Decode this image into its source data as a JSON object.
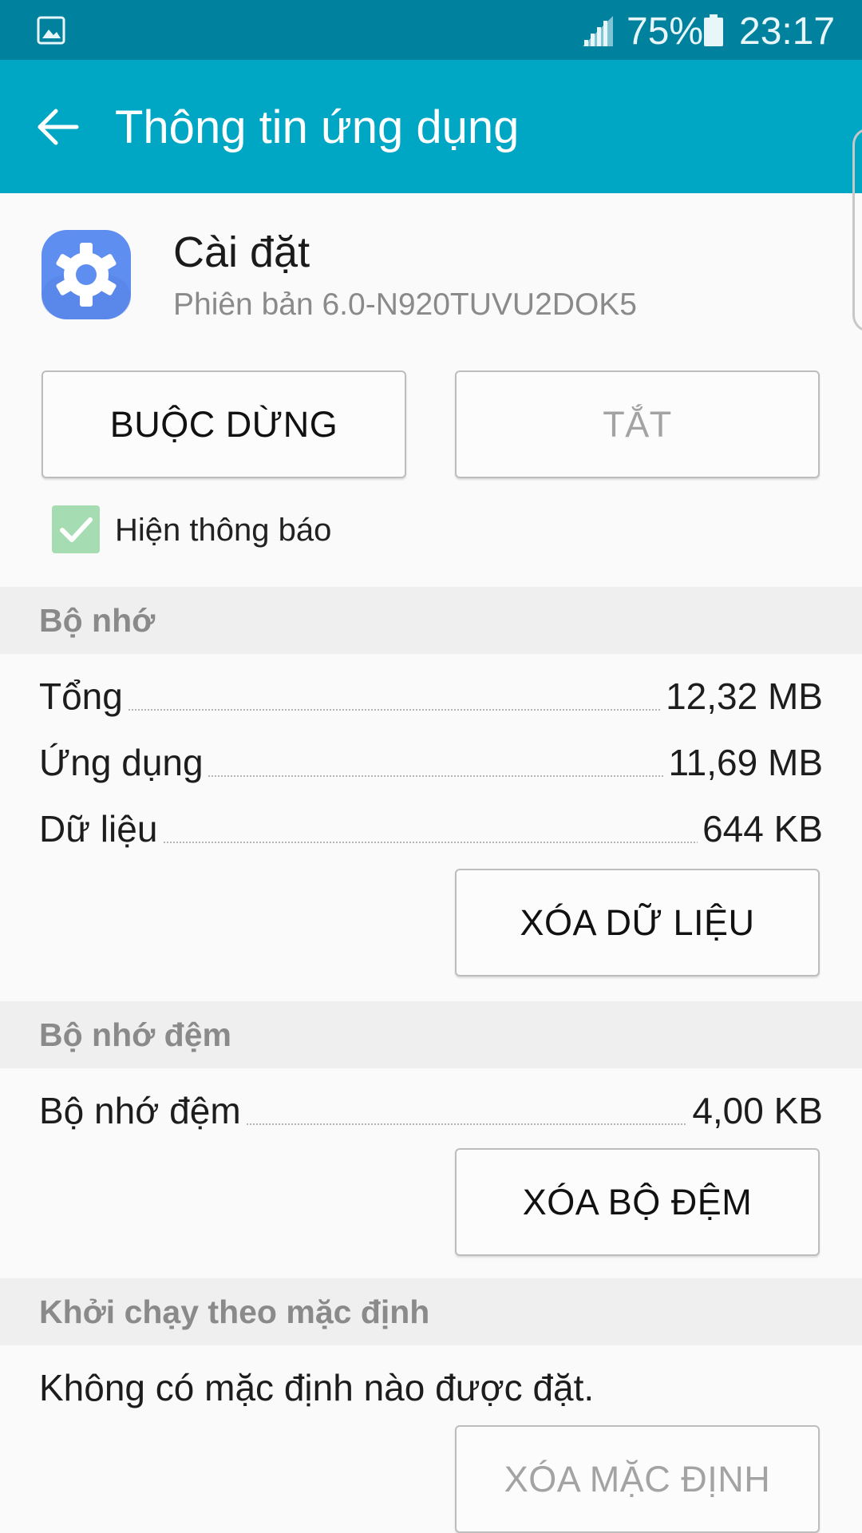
{
  "status_bar": {
    "left_icon": "image-notification-icon",
    "signal_icon": "signal-icon",
    "battery_percent": "75%",
    "battery_icon": "battery-icon",
    "time": "23:17"
  },
  "app_bar": {
    "back_icon": "arrow-back-icon",
    "title": "Thông tin ứng dụng",
    "color": "#00a7c4"
  },
  "app": {
    "icon": "gear-icon",
    "name": "Cài đặt",
    "version": "Phiên bản 6.0-N920TUVU2DOK5"
  },
  "actions": {
    "force_stop": "BUỘC DỪNG",
    "disable": "TẮT"
  },
  "notifications": {
    "label": "Hiện thông báo",
    "checked": true
  },
  "storage": {
    "header": "Bộ nhớ",
    "rows": [
      {
        "label": "Tổng",
        "value": "12,32 MB"
      },
      {
        "label": "Ứng dụng",
        "value": "11,69 MB"
      },
      {
        "label": "Dữ liệu",
        "value": "644 KB"
      }
    ],
    "clear_data": "XÓA DỮ LIỆU"
  },
  "cache": {
    "header": "Bộ nhớ đệm",
    "rows": [
      {
        "label": "Bộ nhớ đệm",
        "value": "4,00 KB"
      }
    ],
    "clear_cache": "XÓA BỘ ĐỆM"
  },
  "launch_default": {
    "header": "Khởi chạy theo mặc định",
    "text": "Không có mặc định nào được đặt.",
    "clear_defaults": "XÓA MẶC ĐỊNH"
  }
}
